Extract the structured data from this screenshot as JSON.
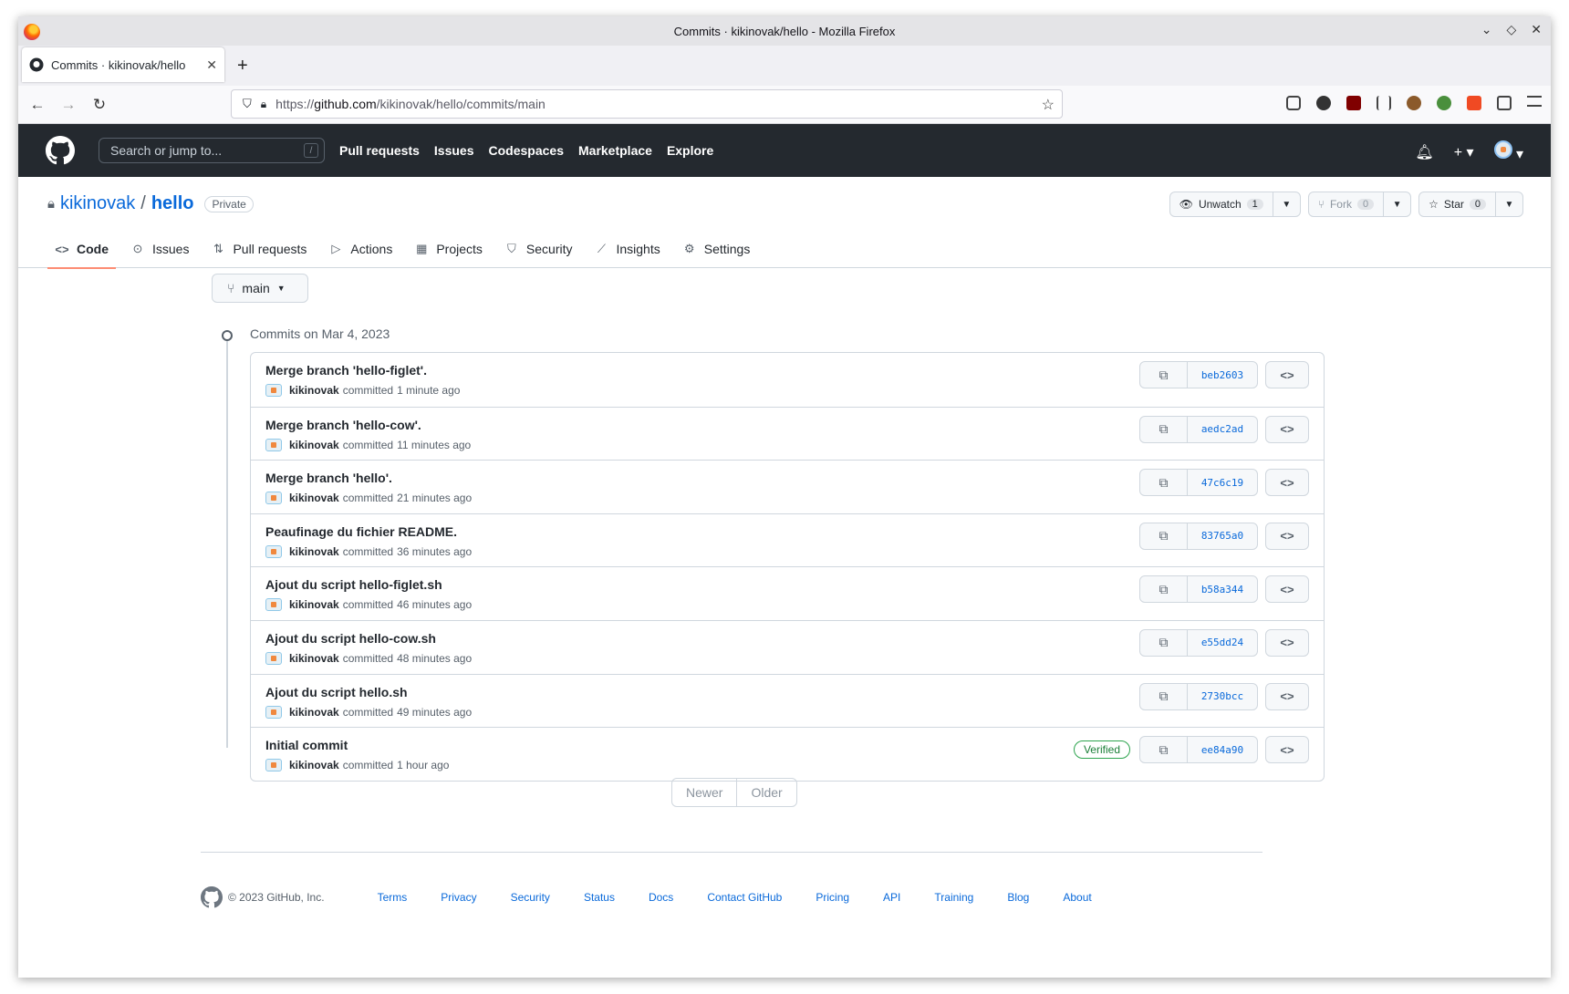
{
  "browser": {
    "window_title": "Commits · kikinovak/hello - Mozilla Firefox",
    "tab_title": "Commits · kikinovak/hello",
    "url_prefix": "https://",
    "url_domain": "github.com",
    "url_path": "/kikinovak/hello/commits/main"
  },
  "gh_header": {
    "search_placeholder": "Search or jump to...",
    "search_key": "/",
    "nav": [
      "Pull requests",
      "Issues",
      "Codespaces",
      "Marketplace",
      "Explore"
    ]
  },
  "repo": {
    "owner": "kikinovak",
    "separator": "/",
    "name": "hello",
    "visibility": "Private",
    "unwatch_label": "Unwatch",
    "watch_count": "1",
    "fork_label": "Fork",
    "fork_count": "0",
    "star_label": "Star",
    "star_count": "0",
    "tabs": [
      {
        "label": "Code",
        "icon": "code-icon"
      },
      {
        "label": "Issues",
        "icon": "issue-icon"
      },
      {
        "label": "Pull requests",
        "icon": "pull-request-icon"
      },
      {
        "label": "Actions",
        "icon": "play-icon"
      },
      {
        "label": "Projects",
        "icon": "table-icon"
      },
      {
        "label": "Security",
        "icon": "shield-icon"
      },
      {
        "label": "Insights",
        "icon": "graph-icon"
      },
      {
        "label": "Settings",
        "icon": "gear-icon"
      }
    ]
  },
  "branch": "main",
  "commits_date": "Commits on Mar 4, 2023",
  "committed_word": "committed",
  "commits": [
    {
      "message": "Merge branch 'hello-figlet'.",
      "author": "kikinovak",
      "time": "1 minute ago",
      "sha": "beb2603",
      "verified": ""
    },
    {
      "message": "Merge branch 'hello-cow'.",
      "author": "kikinovak",
      "time": "11 minutes ago",
      "sha": "aedc2ad",
      "verified": ""
    },
    {
      "message": "Merge branch 'hello'.",
      "author": "kikinovak",
      "time": "21 minutes ago",
      "sha": "47c6c19",
      "verified": ""
    },
    {
      "message": "Peaufinage du fichier README.",
      "author": "kikinovak",
      "time": "36 minutes ago",
      "sha": "83765a0",
      "verified": ""
    },
    {
      "message": "Ajout du script hello-figlet.sh",
      "author": "kikinovak",
      "time": "46 minutes ago",
      "sha": "b58a344",
      "verified": ""
    },
    {
      "message": "Ajout du script hello-cow.sh",
      "author": "kikinovak",
      "time": "48 minutes ago",
      "sha": "e55dd24",
      "verified": ""
    },
    {
      "message": "Ajout du script hello.sh",
      "author": "kikinovak",
      "time": "49 minutes ago",
      "sha": "2730bcc",
      "verified": ""
    },
    {
      "message": "Initial commit",
      "author": "kikinovak",
      "time": "1 hour ago",
      "sha": "ee84a90",
      "verified": "Verified"
    }
  ],
  "pager": {
    "newer": "Newer",
    "older": "Older"
  },
  "footer": {
    "copyright": "© 2023 GitHub, Inc.",
    "links": [
      "Terms",
      "Privacy",
      "Security",
      "Status",
      "Docs",
      "Contact GitHub",
      "Pricing",
      "API",
      "Training",
      "Blog",
      "About"
    ]
  },
  "colors": {
    "header_bg": "#24292f",
    "link": "#0969da",
    "active_tab_underline": "#fd8c73",
    "verified": "#1a7f37"
  }
}
